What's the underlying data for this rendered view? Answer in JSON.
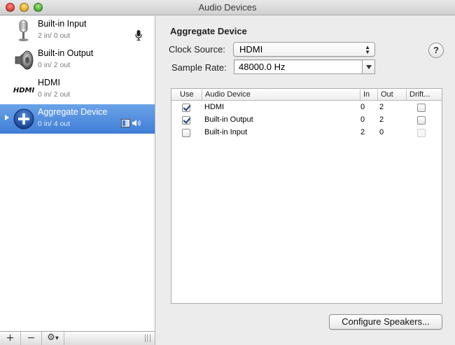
{
  "window": {
    "title": "Audio Devices"
  },
  "sidebar": {
    "devices": [
      {
        "name": "Built-in Input",
        "io": "2 in/ 0 out",
        "icon": "microphone-icon"
      },
      {
        "name": "Built-in Output",
        "io": "0 in/ 2 out",
        "icon": "speaker-icon"
      },
      {
        "name": "HDMI",
        "io": "0 in/ 2 out",
        "icon": "hdmi-icon",
        "icon_text": "HDMI"
      },
      {
        "name": "Aggregate Device",
        "io": "0 in/ 4 out",
        "icon": "plus-icon",
        "selected": true
      }
    ],
    "bottom_bar": {
      "add": "+",
      "remove": "−",
      "gear": "⚙",
      "gear_arrow": "▾"
    }
  },
  "panel": {
    "title": "Aggregate Device",
    "clock_source_label": "Clock Source:",
    "clock_source_value": "HDMI",
    "sample_rate_label": "Sample Rate:",
    "sample_rate_value": "48000.0 Hz",
    "help": "?",
    "table": {
      "headers": {
        "use": "Use",
        "device": "Audio Device",
        "in": "In",
        "out": "Out",
        "drift": "Drift..."
      },
      "rows": [
        {
          "use": true,
          "device": "HDMI",
          "in": "0",
          "out": "2",
          "drift": false
        },
        {
          "use": true,
          "device": "Built-in Output",
          "in": "0",
          "out": "2",
          "drift": false
        },
        {
          "use": false,
          "device": "Built-in Input",
          "in": "2",
          "out": "0",
          "drift": false,
          "drift_disabled": true
        }
      ]
    },
    "configure_button": "Configure Speakers..."
  },
  "colors": {
    "selection": "#4f8ce0",
    "window_bg": "#ececec"
  }
}
